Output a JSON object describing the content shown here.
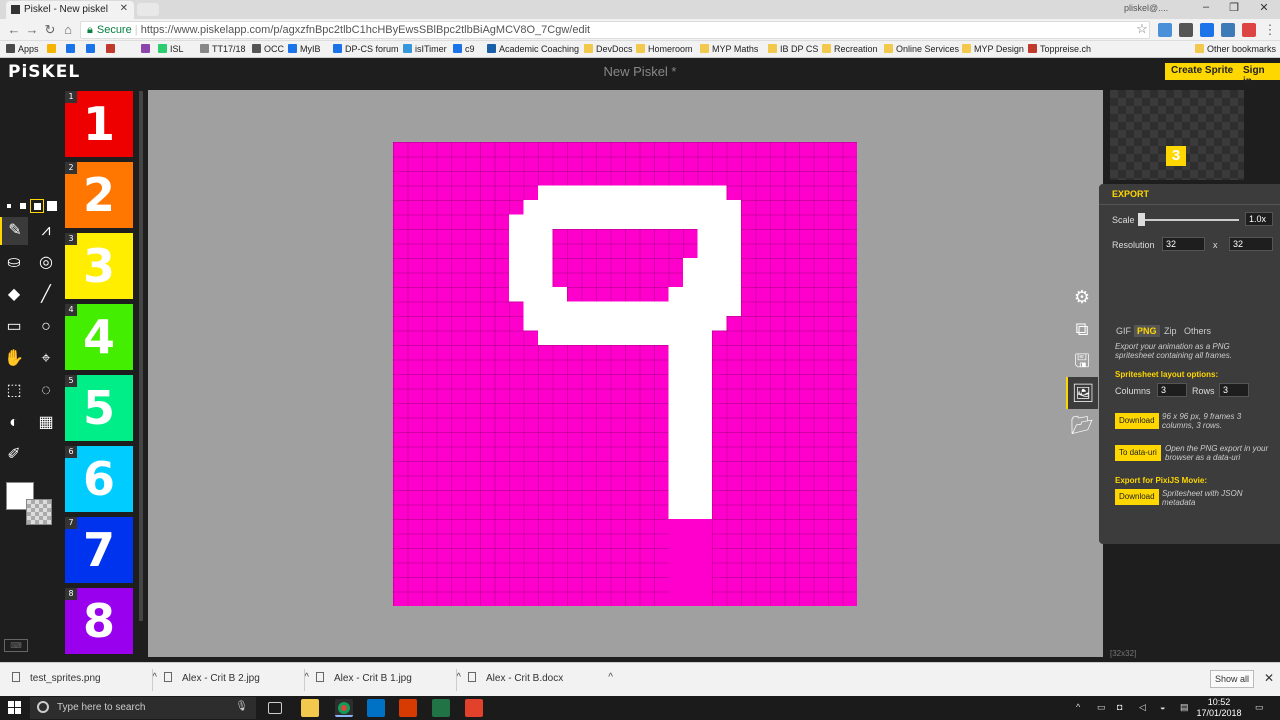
{
  "browser": {
    "tab_title": "Piskel - New piskel",
    "user_name": "pliskel@....",
    "secure_label": "Secure",
    "url": "https://www.piskelapp.com/p/agxzfnBpc2tlbC1hcHByEwsSBlBpc2tlbBiAgMCV8O_7Cgw/edit",
    "bookmarks": [
      {
        "label": "Apps",
        "color": "#4a4a4a"
      },
      {
        "label": "",
        "color": "#f5b400"
      },
      {
        "label": "",
        "color": "#1a73e8"
      },
      {
        "label": "",
        "color": "#1a73e8"
      },
      {
        "label": "",
        "color": "#c0392b"
      },
      {
        "label": "",
        "color": "#8e44ad"
      },
      {
        "label": "ISL",
        "color": "#2ecc71"
      },
      {
        "label": "TT17/18",
        "color": "#888888"
      },
      {
        "label": "OCC",
        "color": "#555555"
      },
      {
        "label": "MyIB",
        "color": "#1a73e8"
      },
      {
        "label": "DP-CS forum",
        "color": "#1a73e8"
      },
      {
        "label": "isITimer",
        "color": "#3498db"
      },
      {
        "label": "c9",
        "color": "#1a73e8"
      },
      {
        "label": "Academic Coaching",
        "color": "#1a5fa8"
      },
      {
        "label": "DevDocs",
        "color": "#f2c94c"
      },
      {
        "label": "Homeroom",
        "color": "#f2c94c"
      },
      {
        "label": "MYP Maths",
        "color": "#f2c94c"
      },
      {
        "label": "IB DP CS",
        "color": "#f2c94c"
      },
      {
        "label": "Recreation",
        "color": "#f2c94c"
      },
      {
        "label": "Online Services",
        "color": "#f2c94c"
      },
      {
        "label": "MYP Design",
        "color": "#f2c94c"
      },
      {
        "label": "Toppreise.ch",
        "color": "#c0392b"
      }
    ],
    "other_bookmarks": "Other bookmarks"
  },
  "app": {
    "logo": "PiSKEL",
    "title": "New Piskel *",
    "create_sprite": "Create Sprite",
    "sign_in": "Sign in",
    "frames": [
      {
        "num": "1",
        "glyph": "1",
        "color": "#ee0000"
      },
      {
        "num": "2",
        "glyph": "2",
        "color": "#ff7700"
      },
      {
        "num": "3",
        "glyph": "3",
        "color": "#ffee00"
      },
      {
        "num": "4",
        "glyph": "4",
        "color": "#44ee00"
      },
      {
        "num": "5",
        "glyph": "5",
        "color": "#00ee88"
      },
      {
        "num": "6",
        "glyph": "6",
        "color": "#00ccff"
      },
      {
        "num": "7",
        "glyph": "7",
        "color": "#0033ee"
      },
      {
        "num": "8",
        "glyph": "8",
        "color": "#9900ee"
      }
    ],
    "canvas_color": "#ff00cc",
    "preview_glyph": "3",
    "size_hint": "[32x32]",
    "export": {
      "title": "EXPORT",
      "scale_label": "Scale",
      "scale_value": "1.0x",
      "scale_fraction": 0.0,
      "resolution_label": "Resolution",
      "width": "32",
      "x_sep": "x",
      "height": "32",
      "tabs": [
        "GIF",
        "PNG",
        "Zip",
        "Others"
      ],
      "active_tab": "PNG",
      "png_desc": "Export your animation as a PNG spritesheet containing all frames.",
      "layout_title": "Spritesheet layout options:",
      "columns_label": "Columns",
      "columns": "3",
      "rows_label": "Rows",
      "rows": "3",
      "download_label": "Download",
      "download_desc": "96 x 96 px, 9 frames 3 columns, 3 rows.",
      "datauri_label": "To data-uri",
      "datauri_desc": "Open the PNG export in your browser as a data-uri",
      "pixi_title": "Export for PixiJS Movie:",
      "pixi_download": "Download",
      "pixi_desc": "Spritesheet with JSON metadata"
    }
  },
  "downloads": [
    {
      "name": "test_sprites.png"
    },
    {
      "name": "Alex - Crit B 2.jpg"
    },
    {
      "name": "Alex - Crit B 1.jpg"
    },
    {
      "name": "Alex - Crit B.docx"
    }
  ],
  "show_all": "Show all",
  "taskbar": {
    "search_placeholder": "Type here to search",
    "time": "10:52",
    "date": "17/01/2018"
  }
}
